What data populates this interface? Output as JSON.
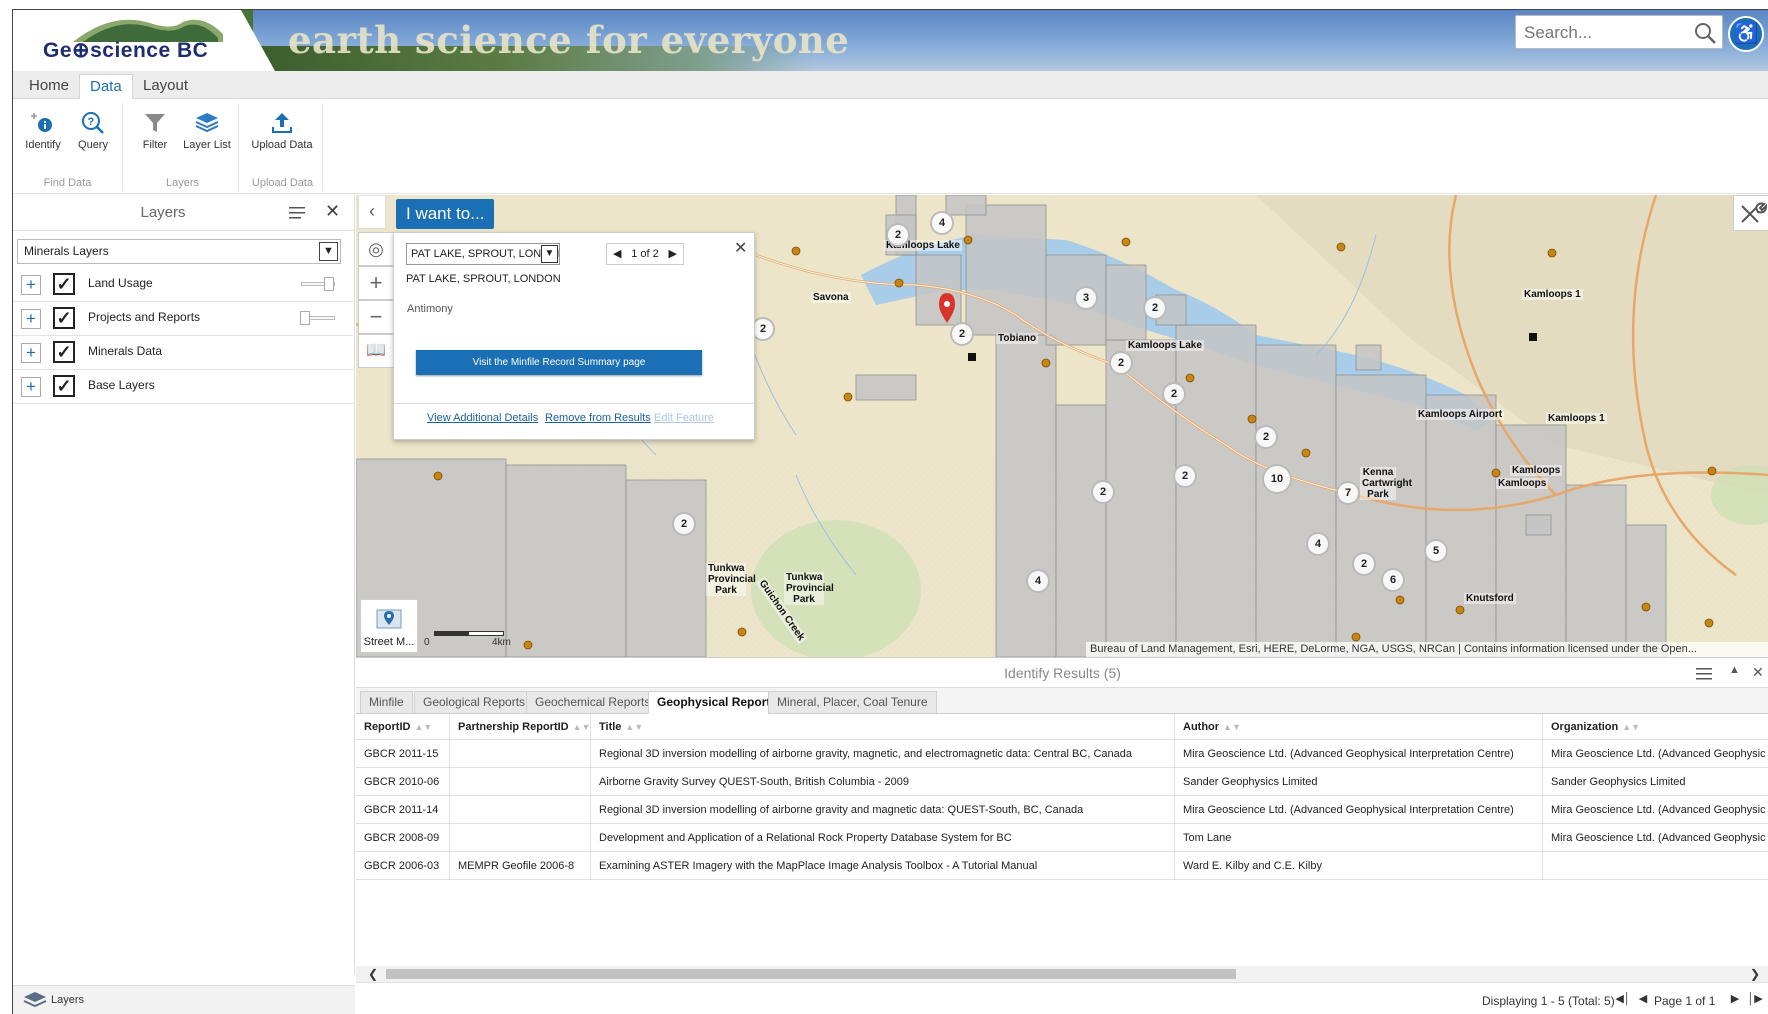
{
  "header": {
    "logo_text": "Ge⊕science BC",
    "tagline": "earth science for everyone",
    "search_placeholder": "Search..."
  },
  "ribbon": {
    "tabs": [
      {
        "label": "Home"
      },
      {
        "label": "Data"
      },
      {
        "label": "Layout"
      }
    ],
    "groups": [
      {
        "label": "Find Data",
        "buttons": [
          {
            "label": "Identify"
          },
          {
            "label": "Query"
          }
        ]
      },
      {
        "label": "Layers",
        "buttons": [
          {
            "label": "Filter"
          },
          {
            "label": "Layer List"
          }
        ]
      },
      {
        "label": "Upload Data",
        "buttons": [
          {
            "label": "Upload Data"
          }
        ]
      }
    ]
  },
  "layers_panel": {
    "title": "Layers",
    "selected_layer_set": "Minerals Layers",
    "layers": [
      {
        "label": "Land Usage",
        "checked": true
      },
      {
        "label": "Projects and Reports",
        "checked": true
      },
      {
        "label": "Minerals Data",
        "checked": true
      },
      {
        "label": "Base Layers",
        "checked": true
      }
    ],
    "footer_tab": "Layers"
  },
  "map": {
    "i_want_to": "I want to...",
    "basemap_label": "Street M...",
    "scale_start": "0",
    "scale_end": "4km",
    "attribution": "Bureau of Land Management, Esri, HERE, DeLorme, NGA, USGS, NRCan | Contains information licensed under the Open...",
    "place_labels": [
      "Kamloops Lake",
      "Savona",
      "Tobiano",
      "Kamloops Lake",
      "Kamloops Airport",
      "Kamloops",
      "Kamloops",
      "Kenna Cartwright Park",
      "Tunkwa Provincial Park",
      "Tunkwa Provincial Park",
      "Knutsford",
      "Kamloops 1",
      "Kamloops 1",
      "Guichon Creek"
    ],
    "clusters": [
      "4",
      "2",
      "3",
      "2",
      "2",
      "2",
      "2",
      "2",
      "2",
      "10",
      "7",
      "2",
      "2",
      "4",
      "2",
      "5",
      "6",
      "4",
      "2"
    ],
    "popup": {
      "select_value": "PAT LAKE, SPROUT, LONDON",
      "pager": "1 of 2",
      "title": "PAT LAKE, SPROUT, LONDON",
      "commodity": "Antimony",
      "visit_button": "Visit the Minfile Record Summary page",
      "link_details": "View Additional Details",
      "link_remove": "Remove from Results",
      "link_edit": "Edit Feature"
    }
  },
  "results": {
    "title": "Identify Results (5)",
    "tabs": [
      {
        "label": "Minfile"
      },
      {
        "label": "Geological Reports"
      },
      {
        "label": "Geochemical Reports"
      },
      {
        "label": "Geophysical Reports"
      },
      {
        "label": "Mineral, Placer, Coal Tenure"
      }
    ],
    "columns": [
      "ReportID",
      "Partnership ReportID",
      "Title",
      "Author",
      "Organization"
    ],
    "rows": [
      [
        "GBCR 2011-15",
        "",
        "Regional 3D inversion modelling of airborne gravity, magnetic, and electromagnetic data: Central BC, Canada",
        "Mira Geoscience Ltd. (Advanced Geophysical Interpretation Centre)",
        "Mira Geoscience Ltd. (Advanced Geophysic"
      ],
      [
        "GBCR 2010-06",
        "",
        "Airborne Gravity Survey QUEST-South, British Columbia - 2009",
        "Sander Geophysics Limited",
        "Sander Geophysics Limited"
      ],
      [
        "GBCR 2011-14",
        "",
        "Regional 3D inversion modelling of airborne gravity and magnetic data: QUEST-South, BC, Canada",
        "Mira Geoscience Ltd. (Advanced Geophysical Interpretation Centre)",
        "Mira Geoscience Ltd. (Advanced Geophysic"
      ],
      [
        "GBCR 2008-09",
        "",
        "Development and Application of a Relational Rock Property Database System for BC",
        "Tom Lane",
        "Mira Geoscience Ltd. (Advanced Geophysic"
      ],
      [
        "GBCR 2006-03",
        "MEMPR Geofile 2006-8",
        "Examining ASTER Imagery with the MapPlace Image Analysis Toolbox - A Tutorial Manual",
        "Ward E. Kilby and C.E. Kilby",
        ""
      ]
    ],
    "paging_text": "Displaying 1 - 5 (Total: 5)",
    "page_text": "Page 1 of 1"
  }
}
